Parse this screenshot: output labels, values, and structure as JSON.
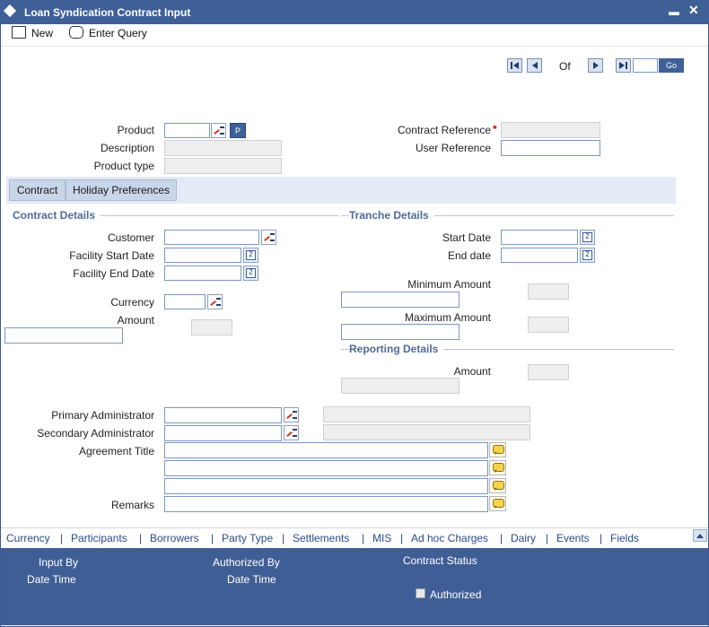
{
  "window": {
    "title": "Loan Syndication Contract Input",
    "minimize_label": "▬",
    "close_label": "✕"
  },
  "toolbar": {
    "new_label": "New",
    "enter_query_label": "Enter Query"
  },
  "pagination": {
    "of_label": "Of",
    "go_label": "Go"
  },
  "header": {
    "product_label": "Product",
    "p_button_label": "P",
    "description_label": "Description",
    "product_type_label": "Product type",
    "contract_reference_label": "Contract Reference",
    "required_mark": "*",
    "user_reference_label": "User Reference"
  },
  "tabs": [
    {
      "label": "Contract"
    },
    {
      "label": "Holiday Preferences"
    }
  ],
  "contract_details": {
    "heading": "Contract Details",
    "customer_label": "Customer",
    "facility_start_label": "Facility Start Date",
    "facility_end_label": "Facility End Date",
    "currency_label": "Currency",
    "amount_label": "Amount"
  },
  "tranche_details": {
    "heading": "Tranche Details",
    "start_date_label": "Start Date",
    "end_date_label": "End date",
    "minimum_amount_label": "Minimum Amount",
    "maximum_amount_label": "Maximum Amount"
  },
  "reporting_details": {
    "heading": "Reporting Details",
    "amount_label": "Amount"
  },
  "admin": {
    "primary_label": "Primary Administrator",
    "secondary_label": "Secondary Administrator",
    "agreement_title_label": "Agreement Title",
    "remarks_label": "Remarks"
  },
  "bottom_links": [
    "Currency",
    "Participants",
    "Borrowers",
    "Party Type",
    "Settlements",
    "MIS",
    "Ad hoc Charges",
    "Dairy",
    "Events",
    "Fields"
  ],
  "separator": "|",
  "footer": {
    "input_by_label": "Input By",
    "date_time_label": "Date Time",
    "authorized_by_label": "Authorized By",
    "date_time_label_2": "Date Time",
    "contract_status_label": "Contract Status",
    "authorized_label": "Authorized"
  },
  "colors": {
    "title_bar": "#3f5f97",
    "footer": "#405e96",
    "section_heading": "#4f6a99",
    "link": "#2a4a8c"
  }
}
